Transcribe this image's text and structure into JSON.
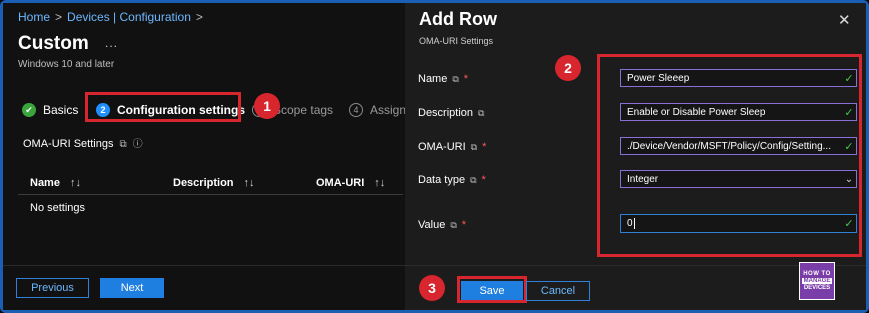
{
  "breadcrumb": {
    "home": "Home",
    "devices": "Devices | Configuration",
    "chevron": ">"
  },
  "page": {
    "title": "Custom",
    "more": "...",
    "subtitle": "Windows 10 and later"
  },
  "steps": [
    {
      "num": "✔",
      "label": "Basics"
    },
    {
      "num": "2",
      "label": "Configuration settings"
    },
    {
      "num": "3",
      "label": "Scope tags"
    },
    {
      "num": "4",
      "label": "Assignments"
    }
  ],
  "oma_section": {
    "label": "OMA-URI Settings"
  },
  "table": {
    "columns": [
      "Name",
      "Description",
      "OMA-URI"
    ],
    "sort_glyph": "↑↓",
    "empty": "No settings"
  },
  "footer": {
    "previous": "Previous",
    "next": "Next"
  },
  "panel": {
    "title": "Add Row",
    "subtitle": "OMA-URI Settings",
    "close": "✕",
    "fields": [
      {
        "label": "Name",
        "value": "Power Sleeep",
        "required": true
      },
      {
        "label": "Description",
        "value": "Enable or Disable Power Sleep",
        "required": false
      },
      {
        "label": "OMA-URI",
        "value": "./Device/Vendor/MSFT/Policy/Config/Setting...",
        "required": true
      },
      {
        "label": "Data type",
        "value": "Integer",
        "required": true
      },
      {
        "label": "Value",
        "value": "0",
        "required": true
      }
    ],
    "save": "Save",
    "cancel": "Cancel"
  },
  "annotations": {
    "one": "1",
    "two": "2",
    "three": "3"
  },
  "logo": {
    "top": "HOW TO",
    "middle": "MANAGE",
    "bottom": "DEVICES"
  },
  "colors": {
    "accent": "#1f7fe0",
    "highlight": "#d7262d",
    "check": "#3fc94a"
  }
}
